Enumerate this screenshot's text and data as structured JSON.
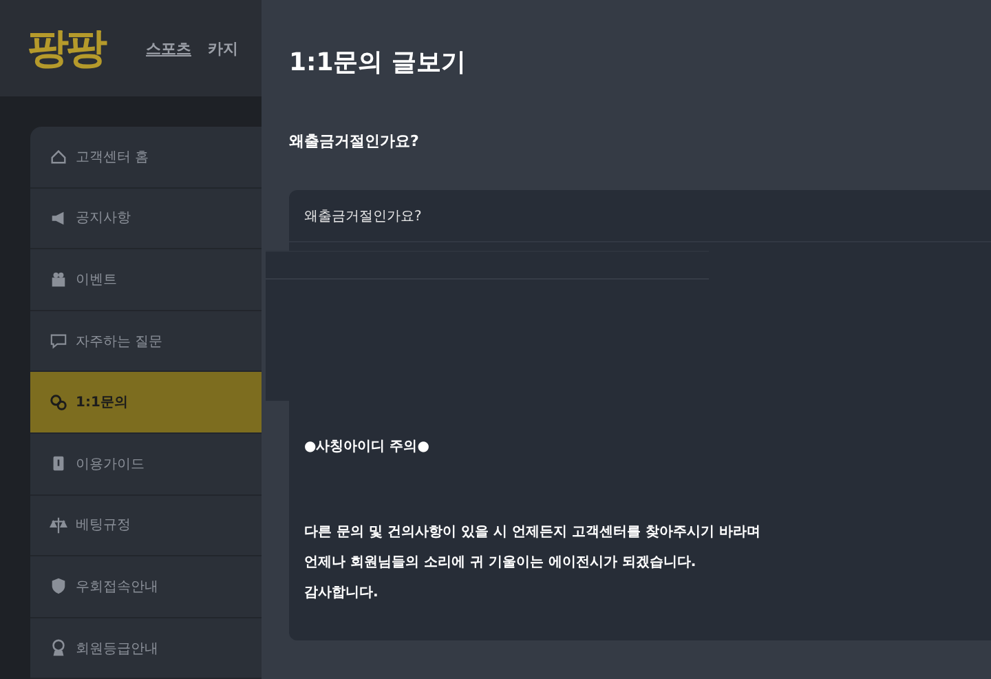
{
  "header": {
    "logo": "팡팡",
    "nav": [
      {
        "label": "스포츠",
        "selected": true
      },
      {
        "label": "카지",
        "selected": false
      }
    ]
  },
  "sidebar": {
    "items": [
      {
        "label": "고객센터 홈",
        "selected": false
      },
      {
        "label": "공지사항",
        "selected": false
      },
      {
        "label": "이벤트",
        "selected": false
      },
      {
        "label": "자주하는 질문",
        "selected": false
      },
      {
        "label": "1:1문의",
        "selected": true
      },
      {
        "label": "이용가이드",
        "selected": false
      },
      {
        "label": "베팅규정",
        "selected": false
      },
      {
        "label": "우회접속안내",
        "selected": false
      },
      {
        "label": "회원등급안내",
        "selected": false
      }
    ]
  },
  "modal": {
    "title": "1:1문의 글보기",
    "subject": "왜출금거절인가요?",
    "question": "왜출금거절인가요?",
    "answer": [
      "●사칭아이디 주의●",
      "다른 문의 및 건의사항이 있을 시 언제든지 고객센터를 찾아주시기 바라며",
      "언제나 회원님들의 소리에 귀 기울이는 에이전시가 되겠습니다.",
      "감사합니다."
    ]
  }
}
